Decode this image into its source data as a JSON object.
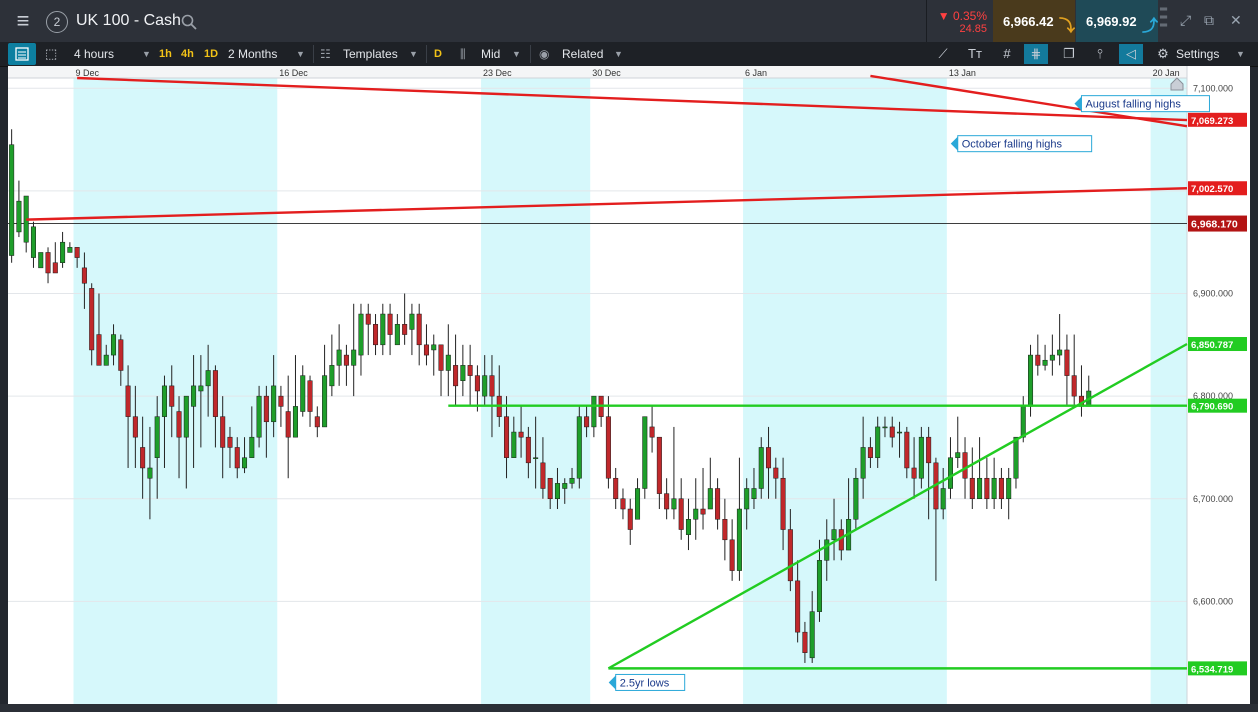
{
  "header": {
    "menu_icon": "hamburger-menu-icon",
    "layout_number": "2",
    "instrument": "UK 100 - Cash",
    "change_pct": "▼ 0.35%",
    "change_abs": "24.85",
    "sell_price": "6,966.42",
    "buy_price": "6,969.92",
    "colors": {
      "sell_bg": "#4a3a1c",
      "buy_bg": "#1f4a57",
      "negative": "#ff4141",
      "sell_arrow": "#e0a020",
      "buy_arrow": "#2aa8d8"
    }
  },
  "toolbar": {
    "timeframe": "4 hours",
    "quick_1h": "1h",
    "quick_4h": "4h",
    "quick_1d": "1D",
    "range": "2 Months",
    "templates": "Templates",
    "d_badge": "D",
    "price_mode": "Mid",
    "related": "Related",
    "settings": "Settings"
  },
  "chart_data": {
    "type": "candlestick",
    "title": "",
    "x_ticks": [
      {
        "label": "9 Dec",
        "i": 9
      },
      {
        "label": "16 Dec",
        "i": 37
      },
      {
        "label": "23 Dec",
        "i": 65
      },
      {
        "label": "30 Dec",
        "i": 80
      },
      {
        "label": "6 Jan",
        "i": 101
      },
      {
        "label": "13 Jan",
        "i": 129
      },
      {
        "label": "20 Jan",
        "i": 157
      }
    ],
    "x_count": 162,
    "ylim": [
      6500,
      7110
    ],
    "y_ticks": [
      {
        "label": "7,100.000",
        "v": 7100
      },
      {
        "label": "7,000.000",
        "v": 7000
      },
      {
        "label": "6,900.000",
        "v": 6900
      },
      {
        "label": "6,800.000",
        "v": 6800
      },
      {
        "label": "6,700.000",
        "v": 6700
      },
      {
        "label": "6,600.000",
        "v": 6600
      }
    ],
    "weekend_bands": [
      [
        9,
        37
      ],
      [
        65,
        80
      ],
      [
        101,
        129
      ],
      [
        157,
        162
      ]
    ],
    "current_price": {
      "label": "6,968.170",
      "v": 6968.17
    },
    "level_labels": [
      {
        "label": "7,069.273",
        "v": 7069.27,
        "color": "#e31e1e"
      },
      {
        "label": "7,002.570",
        "v": 7002.57,
        "color": "#e31e1e"
      },
      {
        "label": "6,850.787",
        "v": 6850.79,
        "color": "#22cc22"
      },
      {
        "label": "6,790.690",
        "v": 6790.69,
        "color": "#22cc22"
      },
      {
        "label": "6,534.719",
        "v": 6534.72,
        "color": "#22cc22"
      }
    ],
    "lines": [
      {
        "name": "august-falling-highs-line",
        "color": "#e31e1e",
        "i1": 9,
        "v1": 7110,
        "i2": 162,
        "v2": 7069
      },
      {
        "name": "october-falling-highs-line",
        "color": "#e31e1e",
        "i1": 118,
        "v1": 7112,
        "i2": 162,
        "v2": 7063
      },
      {
        "name": "resistance-line",
        "color": "#e31e1e",
        "i1": 2,
        "v1": 6972,
        "i2": 162,
        "v2": 7002.57
      },
      {
        "name": "uptrend-line",
        "color": "#22cc22",
        "i1": 82,
        "v1": 6534.72,
        "i2": 162,
        "v2": 6850.79
      },
      {
        "name": "horizontal-support-line",
        "color": "#22cc22",
        "i1": 60,
        "v1": 6790.69,
        "i2": 162,
        "v2": 6790.69
      },
      {
        "name": "low-support-line",
        "color": "#22cc22",
        "i1": 82,
        "v1": 6534.72,
        "i2": 162,
        "v2": 6534.72
      }
    ],
    "annotations": [
      {
        "text": "August falling highs",
        "i": 147,
        "v": 7085
      },
      {
        "text": "October falling highs",
        "i": 130,
        "v": 7046
      },
      {
        "text": "2.5yr lows",
        "i": 83,
        "v": 6521
      }
    ],
    "candles": [
      [
        6937,
        7045,
        7060,
        6930
      ],
      [
        6960,
        6990,
        7010,
        6955
      ],
      [
        6950,
        6995,
        6990,
        6940
      ],
      [
        6935,
        6965,
        6970,
        6925
      ],
      [
        6925,
        6940,
        6940,
        6935
      ],
      [
        6940,
        6920,
        6945,
        6910
      ],
      [
        6930,
        6920,
        6950,
        6930
      ],
      [
        6930,
        6950,
        6960,
        6925
      ],
      [
        6940,
        6945,
        6950,
        6940
      ],
      [
        6945,
        6935,
        6945,
        6925
      ],
      [
        6925,
        6910,
        6940,
        6885
      ],
      [
        6905,
        6845,
        6910,
        6830
      ],
      [
        6860,
        6830,
        6900,
        6835
      ],
      [
        6830,
        6840,
        6850,
        6830
      ],
      [
        6840,
        6860,
        6870,
        6830
      ],
      [
        6855,
        6825,
        6860,
        6810
      ],
      [
        6810,
        6780,
        6830,
        6730
      ],
      [
        6780,
        6760,
        6810,
        6730
      ],
      [
        6750,
        6730,
        6780,
        6700
      ],
      [
        6720,
        6730,
        6770,
        6680
      ],
      [
        6740,
        6780,
        6800,
        6700
      ],
      [
        6780,
        6810,
        6820,
        6730
      ],
      [
        6810,
        6790,
        6830,
        6760
      ],
      [
        6785,
        6760,
        6800,
        6720
      ],
      [
        6760,
        6800,
        6800,
        6710
      ],
      [
        6790,
        6810,
        6840,
        6730
      ],
      [
        6805,
        6810,
        6840,
        6750
      ],
      [
        6810,
        6825,
        6850,
        6780
      ],
      [
        6825,
        6780,
        6830,
        6750
      ],
      [
        6780,
        6750,
        6800,
        6720
      ],
      [
        6760,
        6750,
        6770,
        6730
      ],
      [
        6750,
        6730,
        6760,
        6720
      ],
      [
        6730,
        6740,
        6760,
        6725
      ],
      [
        6740,
        6760,
        6790,
        6740
      ],
      [
        6760,
        6800,
        6810,
        6750
      ],
      [
        6800,
        6775,
        6810,
        6740
      ],
      [
        6775,
        6810,
        6840,
        6760
      ],
      [
        6800,
        6790,
        6810,
        6770
      ],
      [
        6785,
        6760,
        6820,
        6720
      ],
      [
        6760,
        6790,
        6840,
        6760
      ],
      [
        6785,
        6820,
        6830,
        6780
      ],
      [
        6815,
        6785,
        6820,
        6770
      ],
      [
        6780,
        6770,
        6790,
        6760
      ],
      [
        6770,
        6820,
        6850,
        6770
      ],
      [
        6810,
        6830,
        6860,
        6800
      ],
      [
        6830,
        6845,
        6870,
        6810
      ],
      [
        6840,
        6830,
        6850,
        6810
      ],
      [
        6830,
        6845,
        6890,
        6800
      ],
      [
        6840,
        6880,
        6890,
        6820
      ],
      [
        6880,
        6870,
        6890,
        6840
      ],
      [
        6870,
        6850,
        6880,
        6840
      ],
      [
        6850,
        6880,
        6890,
        6840
      ],
      [
        6880,
        6860,
        6890,
        6840
      ],
      [
        6850,
        6870,
        6880,
        6855
      ],
      [
        6870,
        6860,
        6900,
        6850
      ],
      [
        6865,
        6880,
        6890,
        6840
      ],
      [
        6880,
        6850,
        6890,
        6830
      ],
      [
        6850,
        6840,
        6870,
        6830
      ],
      [
        6845,
        6850,
        6860,
        6820
      ],
      [
        6850,
        6825,
        6850,
        6800
      ],
      [
        6825,
        6840,
        6870,
        6800
      ],
      [
        6830,
        6810,
        6860,
        6790
      ],
      [
        6815,
        6830,
        6850,
        6800
      ],
      [
        6830,
        6820,
        6850,
        6790
      ],
      [
        6820,
        6805,
        6830,
        6785
      ],
      [
        6800,
        6820,
        6840,
        6790
      ],
      [
        6820,
        6800,
        6840,
        6760
      ],
      [
        6800,
        6780,
        6830,
        6770
      ],
      [
        6780,
        6740,
        6800,
        6720
      ],
      [
        6740,
        6765,
        6780,
        6740
      ],
      [
        6765,
        6760,
        6790,
        6740
      ],
      [
        6760,
        6735,
        6770,
        6720
      ],
      [
        6740,
        6740,
        6780,
        6710
      ],
      [
        6735,
        6710,
        6760,
        6700
      ],
      [
        6720,
        6700,
        6720,
        6690
      ],
      [
        6700,
        6715,
        6730,
        6690
      ],
      [
        6710,
        6715,
        6720,
        6695
      ],
      [
        6715,
        6720,
        6730,
        6710
      ],
      [
        6720,
        6780,
        6790,
        6710
      ],
      [
        6780,
        6770,
        6790,
        6760
      ],
      [
        6770,
        6800,
        6800,
        6760
      ],
      [
        6800,
        6780,
        6790,
        6770
      ],
      [
        6780,
        6720,
        6800,
        6710
      ],
      [
        6720,
        6700,
        6730,
        6690
      ],
      [
        6700,
        6690,
        6710,
        6680
      ],
      [
        6690,
        6670,
        6700,
        6655
      ],
      [
        6680,
        6710,
        6720,
        6680
      ],
      [
        6710,
        6780,
        6780,
        6700
      ],
      [
        6770,
        6760,
        6790,
        6745
      ],
      [
        6760,
        6705,
        6760,
        6690
      ],
      [
        6705,
        6690,
        6720,
        6680
      ],
      [
        6690,
        6700,
        6770,
        6680
      ],
      [
        6700,
        6670,
        6720,
        6660
      ],
      [
        6665,
        6680,
        6700,
        6650
      ],
      [
        6680,
        6690,
        6720,
        6660
      ],
      [
        6690,
        6685,
        6730,
        6670
      ],
      [
        6690,
        6710,
        6740,
        6690
      ],
      [
        6710,
        6680,
        6720,
        6670
      ],
      [
        6680,
        6660,
        6700,
        6640
      ],
      [
        6660,
        6630,
        6680,
        6620
      ],
      [
        6630,
        6690,
        6740,
        6620
      ],
      [
        6690,
        6710,
        6720,
        6670
      ],
      [
        6700,
        6710,
        6730,
        6690
      ],
      [
        6710,
        6750,
        6760,
        6700
      ],
      [
        6750,
        6730,
        6770,
        6700
      ],
      [
        6730,
        6720,
        6740,
        6700
      ],
      [
        6720,
        6670,
        6740,
        6650
      ],
      [
        6670,
        6620,
        6690,
        6610
      ],
      [
        6620,
        6570,
        6640,
        6560
      ],
      [
        6570,
        6550,
        6580,
        6540
      ],
      [
        6545,
        6590,
        6610,
        6540
      ],
      [
        6590,
        6640,
        6660,
        6580
      ],
      [
        6640,
        6660,
        6680,
        6620
      ],
      [
        6660,
        6670,
        6700,
        6640
      ],
      [
        6670,
        6650,
        6680,
        6640
      ],
      [
        6650,
        6680,
        6720,
        6650
      ],
      [
        6680,
        6720,
        6730,
        6670
      ],
      [
        6720,
        6750,
        6780,
        6700
      ],
      [
        6750,
        6740,
        6760,
        6730
      ],
      [
        6740,
        6770,
        6780,
        6730
      ],
      [
        6770,
        6770,
        6780,
        6760
      ],
      [
        6770,
        6760,
        6780,
        6750
      ],
      [
        6765,
        6765,
        6775,
        6740
      ],
      [
        6765,
        6730,
        6770,
        6720
      ],
      [
        6730,
        6720,
        6760,
        6700
      ],
      [
        6720,
        6760,
        6770,
        6710
      ],
      [
        6760,
        6735,
        6770,
        6680
      ],
      [
        6735,
        6690,
        6740,
        6620
      ],
      [
        6690,
        6710,
        6730,
        6680
      ],
      [
        6710,
        6740,
        6760,
        6700
      ],
      [
        6740,
        6745,
        6780,
        6730
      ],
      [
        6745,
        6720,
        6760,
        6700
      ],
      [
        6720,
        6700,
        6750,
        6690
      ],
      [
        6700,
        6720,
        6760,
        6700
      ],
      [
        6720,
        6700,
        6740,
        6690
      ],
      [
        6700,
        6720,
        6740,
        6690
      ],
      [
        6720,
        6700,
        6730,
        6690
      ],
      [
        6700,
        6720,
        6730,
        6680
      ],
      [
        6720,
        6760,
        6760,
        6710
      ],
      [
        6760,
        6790,
        6800,
        6755
      ],
      [
        6790,
        6840,
        6850,
        6780
      ],
      [
        6840,
        6830,
        6860,
        6820
      ],
      [
        6830,
        6835,
        6850,
        6825
      ],
      [
        6835,
        6840,
        6860,
        6820
      ],
      [
        6840,
        6845,
        6880,
        6830
      ],
      [
        6845,
        6820,
        6860,
        6790
      ],
      [
        6820,
        6800,
        6860,
        6790
      ],
      [
        6800,
        6790,
        6830,
        6780
      ],
      [
        6790,
        6805,
        6820,
        6790
      ]
    ]
  }
}
